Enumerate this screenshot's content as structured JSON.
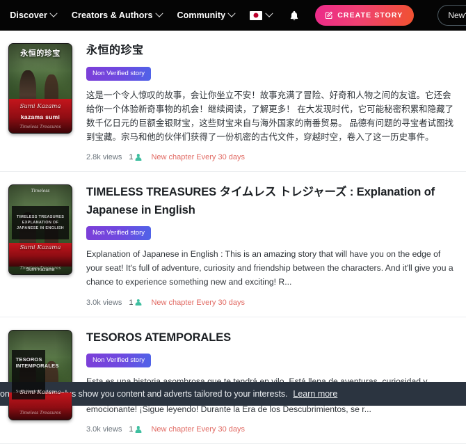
{
  "navbar": {
    "items": [
      {
        "label": "Discover",
        "icon": "chevron-down-icon"
      },
      {
        "label": "Creators & Authors",
        "icon": "chevron-down-icon"
      },
      {
        "label": "Community",
        "icon": "chevron-down-icon"
      }
    ],
    "language_flag": "japan-flag-icon",
    "notifications_icon": "bell-icon",
    "create_story": {
      "label": "CREATE STORY",
      "icon": "edit-square-icon"
    },
    "new_button": {
      "label": "New?"
    },
    "background": "#050505",
    "create_gradient_from": "#ec2a8a",
    "create_gradient_to": "#f0522f"
  },
  "badge_label": "Non Verified story",
  "badge_gradient_from": "#7c3fd8",
  "badge_gradient_to": "#4f63e8",
  "chapter_color": "#e16a63",
  "stories": [
    {
      "title": "永恒的珍宝",
      "badge": "Non Verified story",
      "description": "这是一个令人惊叹的故事，会让你坐立不安！故事充满了冒险、好奇和人物之间的友谊。它还会给你一个体验新奇事物的机会！继续阅读，了解更多！ 在大发现时代，它可能秘密积累和隐藏了数千亿日元的巨额金银财宝，这些财宝来自与海外国家的南番贸易。 品德有问题的寻宝者试图找到宝藏。宗马和他的伙伴们获得了一份机密的古代文件，穿越时空，卷入了这一历史事件。",
      "views": "2.8k views",
      "authors_count": "1",
      "chapter_info": "New chapter Every 30 days",
      "cover": {
        "title_text": "永恒的珍宝",
        "author_script": "Sumi Kazama",
        "author_bold": "kazama sumi",
        "footer_text": "Timeless Treasures"
      }
    },
    {
      "title": "TIMELESS TREASURES タイムレス トレジャーズ : Explanation of Japanese in English",
      "badge": "Non Verified story",
      "description": "Explanation of Japanese in English : This is an amazing story that will have you on the edge of your seat! It's full of adventure, curiosity and friendship between the characters. And it'll give you a chance to experience something new and exciting! R...",
      "views": "3.0k views",
      "authors_count": "1",
      "chapter_info": "New chapter Every 30 days",
      "cover": {
        "top_mark": "Timeless",
        "panel_text": "TIMELESS TREASURES EXPLANATION OF JAPANESE IN ENGLISH",
        "author_script": "Sumi Kazama",
        "author_sub": "Timeless Treasures",
        "bottom_name": "Sumi Kazama"
      }
    },
    {
      "title": "TESOROS ATEMPORALES",
      "badge": "Non Verified story",
      "description": "Esta es una historia asombrosa que te tendrá en vilo. Está llena de aventuras, curiosidad y amistad entre los personajes. ¡Y te dará la oportunidad de experimentar algo nuevo y emocionante! ¡Sigue leyendo! Durante la Era de los Descubrimientos, se r...",
      "views": "3.0k views",
      "authors_count": "1",
      "chapter_info": "New chapter Every 30 days",
      "cover": {
        "panel_title": "TESOROS INTEMPORALES",
        "panel_sub": "Sumi Kazama",
        "author_script": "Sumi Kazama",
        "author_sub": "Timeless Treasures"
      }
    }
  ],
  "cookie_banner": {
    "text": "on our website, plus show you content and adverts tailored to your interests.",
    "link_label": "Learn more",
    "background": "#2b3440"
  }
}
